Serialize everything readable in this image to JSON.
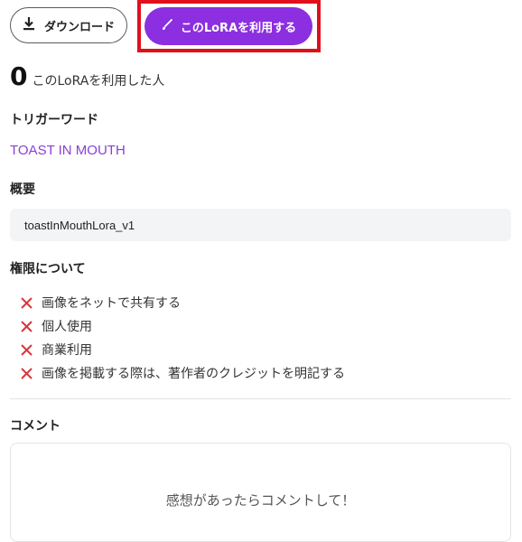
{
  "actions": {
    "download_label": "ダウンロード",
    "use_lora_label": "このLoRAを利用する"
  },
  "usage": {
    "count": "0",
    "text": "このLoRAを利用した人"
  },
  "trigger": {
    "heading": "トリガーワード",
    "word": "TOAST IN MOUTH"
  },
  "overview": {
    "heading": "概要",
    "text": "toastInMouthLora_v1"
  },
  "permissions": {
    "heading": "権限について",
    "items": [
      {
        "label": "画像をネットで共有する",
        "allowed": false
      },
      {
        "label": "個人使用",
        "allowed": false
      },
      {
        "label": "商業利用",
        "allowed": false
      },
      {
        "label": "画像を掲載する際は、著作者のクレジットを明記する",
        "allowed": false
      }
    ]
  },
  "comments": {
    "heading": "コメント",
    "placeholder": "感想があったらコメントして！"
  },
  "colors": {
    "accent": "#8b2fe0",
    "trigger_text": "#8a3fd6",
    "deny_icon": "#d9363e",
    "highlight": "#e0101a"
  }
}
